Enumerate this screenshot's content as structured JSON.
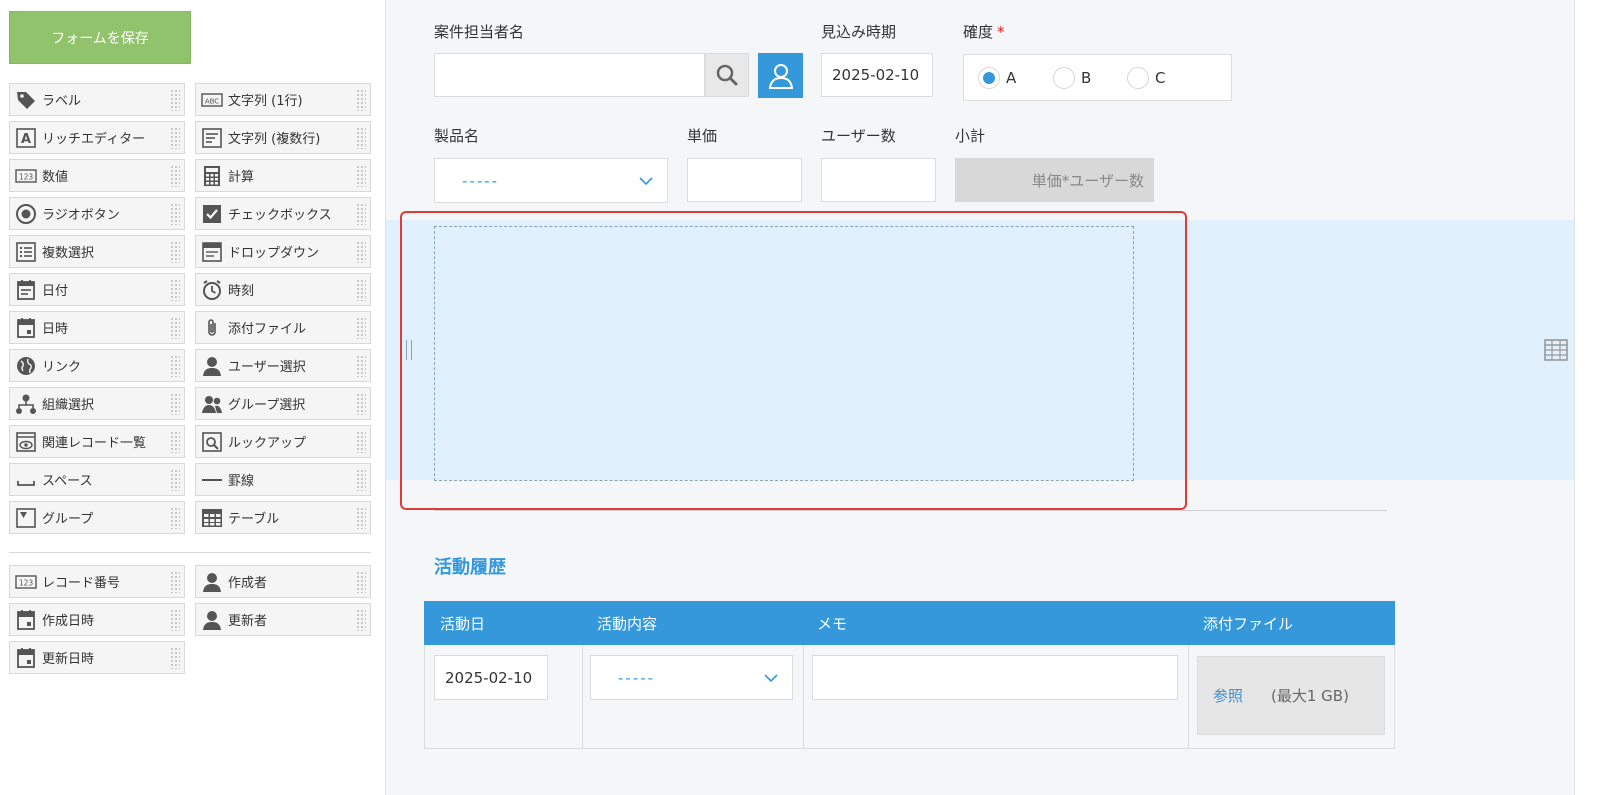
{
  "sidebar": {
    "save_label": "フォームを保存",
    "palette": [
      {
        "label": "ラベル",
        "icon": "tag-icon"
      },
      {
        "label": "文字列 (1行)",
        "icon": "abc-icon"
      },
      {
        "label": "リッチエディター",
        "icon": "rich-editor-icon"
      },
      {
        "label": "文字列 (複数行)",
        "icon": "multiline-text-icon"
      },
      {
        "label": "数値",
        "icon": "number-icon"
      },
      {
        "label": "計算",
        "icon": "calculator-icon"
      },
      {
        "label": "ラジオボタン",
        "icon": "radio-icon"
      },
      {
        "label": "チェックボックス",
        "icon": "checkbox-icon"
      },
      {
        "label": "複数選択",
        "icon": "multi-select-icon"
      },
      {
        "label": "ドロップダウン",
        "icon": "dropdown-icon"
      },
      {
        "label": "日付",
        "icon": "date-icon"
      },
      {
        "label": "時刻",
        "icon": "clock-icon"
      },
      {
        "label": "日時",
        "icon": "datetime-icon"
      },
      {
        "label": "添付ファイル",
        "icon": "paperclip-icon"
      },
      {
        "label": "リンク",
        "icon": "globe-icon"
      },
      {
        "label": "ユーザー選択",
        "icon": "user-icon"
      },
      {
        "label": "組織選択",
        "icon": "org-icon"
      },
      {
        "label": "グループ選択",
        "icon": "group-icon"
      },
      {
        "label": "関連レコード一覧",
        "icon": "related-records-icon"
      },
      {
        "label": "ルックアップ",
        "icon": "lookup-icon"
      },
      {
        "label": "スペース",
        "icon": "space-icon"
      },
      {
        "label": "罫線",
        "icon": "line-icon"
      },
      {
        "label": "グループ",
        "icon": "group-field-icon"
      },
      {
        "label": "テーブル",
        "icon": "table-icon"
      }
    ],
    "system": [
      {
        "label": "レコード番号",
        "icon": "number-icon"
      },
      {
        "label": "作成者",
        "icon": "user-icon"
      },
      {
        "label": "作成日時",
        "icon": "datetime-icon"
      },
      {
        "label": "更新者",
        "icon": "user-icon"
      },
      {
        "label": "更新日時",
        "icon": "datetime-icon"
      }
    ]
  },
  "form": {
    "owner_label": "案件担当者名",
    "owner_value": "",
    "forecast_label": "見込み時期",
    "forecast_value": "2025-02-10",
    "certainty_label": "確度",
    "certainty_required": "*",
    "certainty_options": [
      "A",
      "B",
      "C"
    ],
    "certainty_selected": "A",
    "product_label": "製品名",
    "product_value": "-----",
    "price_label": "単価",
    "users_label": "ユーザー数",
    "subtotal_label": "小計",
    "subtotal_formula": "単価*ユーザー数"
  },
  "activity": {
    "title": "活動履歴",
    "headers": [
      "活動日",
      "活動内容",
      "メモ",
      "添付ファイル"
    ],
    "row": {
      "date": "2025-02-10",
      "content": "-----",
      "memo": "",
      "browse": "参照",
      "limit": "(最大1 GB)"
    }
  },
  "colors": {
    "accent": "#3498db",
    "save": "#91c36c",
    "highlight": "#e03b3b",
    "dropzone": "#e0f0fc"
  }
}
